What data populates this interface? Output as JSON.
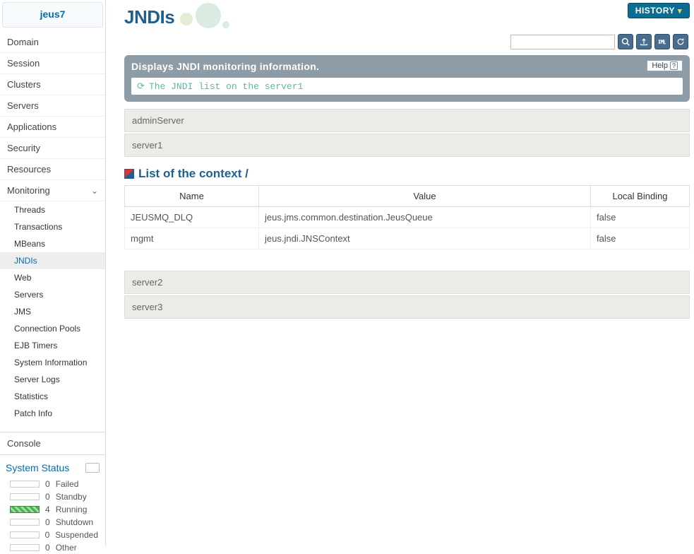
{
  "logo": "jeus7",
  "nav": [
    "Domain",
    "Session",
    "Clusters",
    "Servers",
    "Applications",
    "Security",
    "Resources"
  ],
  "nav_monitoring": "Monitoring",
  "subnav": [
    "Threads",
    "Transactions",
    "MBeans",
    "JNDIs",
    "Web",
    "Servers",
    "JMS",
    "Connection Pools",
    "EJB Timers",
    "System Information",
    "Server Logs",
    "Statistics",
    "Patch Info"
  ],
  "subnav_active_index": 3,
  "console": "Console",
  "system_status_title": "System Status",
  "status_rows": [
    {
      "n": "0",
      "label": "Failed",
      "running": false
    },
    {
      "n": "0",
      "label": "Standby",
      "running": false
    },
    {
      "n": "4",
      "label": "Running",
      "running": true
    },
    {
      "n": "0",
      "label": "Shutdown",
      "running": false
    },
    {
      "n": "0",
      "label": "Suspended",
      "running": false
    },
    {
      "n": "0",
      "label": "Other",
      "running": false
    }
  ],
  "history_label": "HISTORY",
  "page_title": "JNDIs",
  "search": {
    "placeholder": ""
  },
  "banner_text": "Displays JNDI monitoring information.",
  "help_label": "Help",
  "inner_bar_text": "The JNDI list on the server1",
  "servers_top": [
    "adminServer",
    "server1"
  ],
  "context_heading": "List of the context /",
  "table_headers": [
    "Name",
    "Value",
    "Local Binding"
  ],
  "table_rows": [
    {
      "name": "JEUSMQ_DLQ",
      "value": "jeus.jms.common.destination.JeusQueue",
      "binding": "false"
    },
    {
      "name": "mgmt",
      "value": "jeus.jndi.JNSContext",
      "binding": "false"
    }
  ],
  "servers_bottom": [
    "server2",
    "server3"
  ]
}
